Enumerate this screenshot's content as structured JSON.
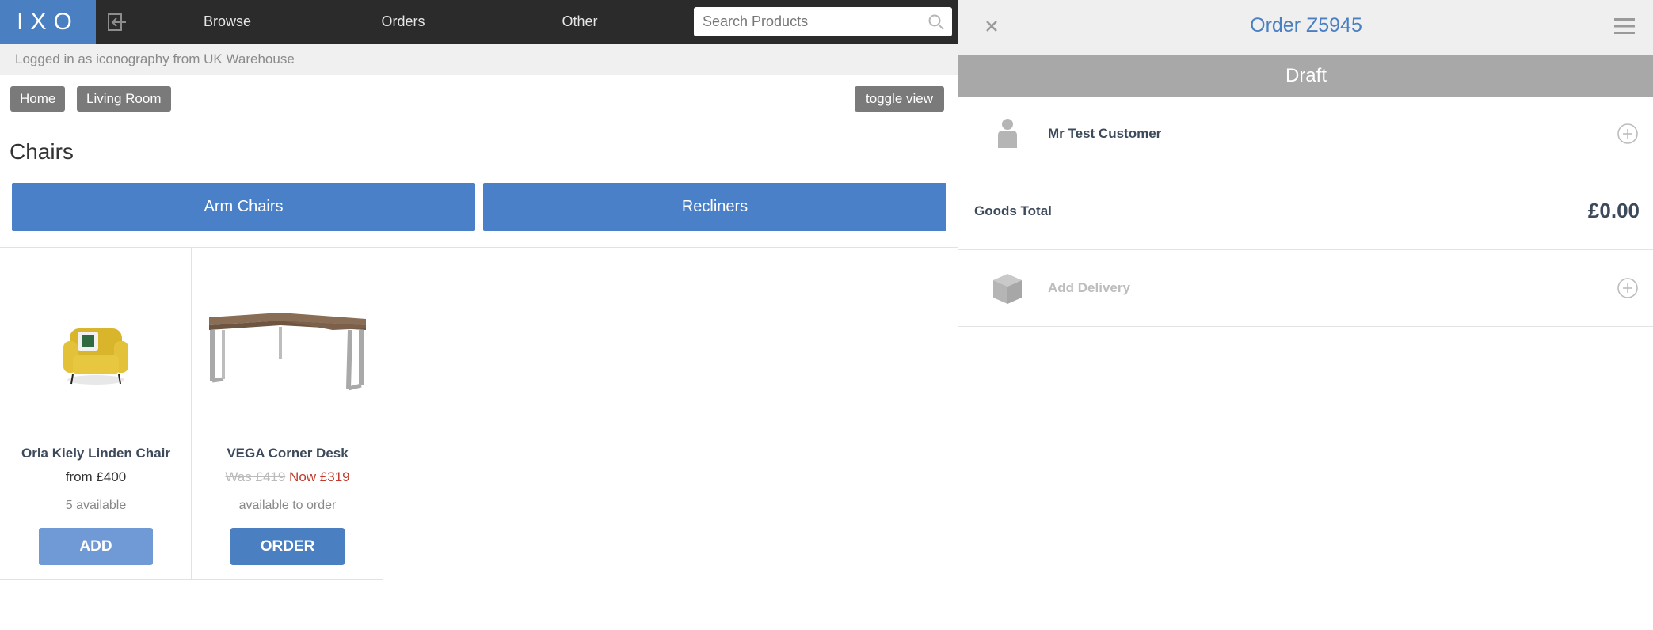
{
  "header": {
    "logo_text": "IXO",
    "nav": [
      "Browse",
      "Orders",
      "Other"
    ],
    "search_placeholder": "Search Products"
  },
  "login_text": "Logged in as iconography from UK Warehouse",
  "breadcrumbs": [
    "Home",
    "Living Room"
  ],
  "toggle_label": "toggle view",
  "category_title": "Chairs",
  "subcategories": [
    "Arm Chairs",
    "Recliners"
  ],
  "products": [
    {
      "name": "Orla Kiely Linden Chair",
      "price": "from £400",
      "stock": "5 available",
      "button": "ADD",
      "button_color": "#6f9ad6"
    },
    {
      "name": "VEGA Corner Desk",
      "was_price": "Was £419",
      "now_price": "Now £319",
      "stock": "available to order",
      "button": "ORDER",
      "button_color": "#4a7fc1"
    }
  ],
  "order": {
    "title": "Order Z5945",
    "status": "Draft",
    "customer": "Mr Test Customer",
    "goods_total_label": "Goods Total",
    "goods_total_value": "£0.00",
    "delivery_label": "Add Delivery"
  },
  "colors": {
    "accent": "#4a7fc1",
    "topbar": "#2b2b2b",
    "status_bar": "#a8a8a8"
  }
}
